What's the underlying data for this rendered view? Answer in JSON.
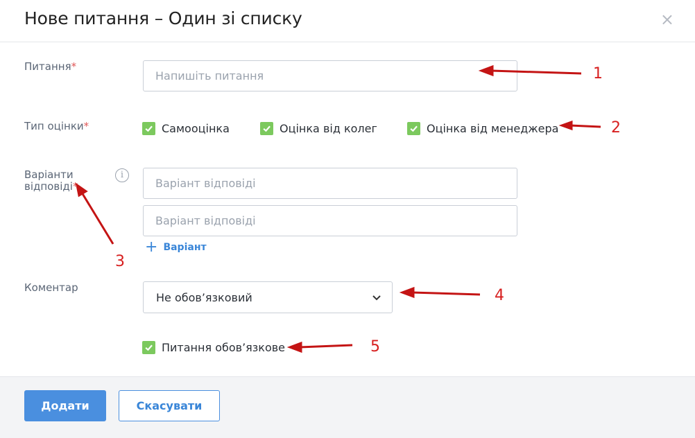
{
  "dialog": {
    "title": "Нове питання – Один зі списку",
    "close_label": "×"
  },
  "question": {
    "label": "Питання",
    "required_mark": "*",
    "placeholder": "Напишіть питання",
    "value": ""
  },
  "assessment_type": {
    "label": "Тип оцінки",
    "required_mark": "*",
    "options": [
      {
        "label": "Самооцінка",
        "checked": true
      },
      {
        "label": "Оцінка від колег",
        "checked": true
      },
      {
        "label": "Оцінка від менеджера",
        "checked": true
      }
    ]
  },
  "answers": {
    "label": "Варіанти відповіді",
    "required_mark": "*",
    "info_icon": "info-icon",
    "placeholder": "Варіант відповіді",
    "items": [
      "",
      ""
    ],
    "add_label": "Варіант"
  },
  "comment": {
    "label": "Коментар",
    "selected": "Не обов’язковий"
  },
  "required_question": {
    "label": "Питання обов’язкове",
    "checked": true
  },
  "footer": {
    "add_button": "Додати",
    "cancel_button": "Скасувати"
  },
  "annotations": [
    "1",
    "2",
    "3",
    "4",
    "5"
  ],
  "colors": {
    "primary": "#4a8fdf",
    "checkbox": "#7cc95e",
    "required": "#e05757",
    "annotation": "#d71f1f"
  }
}
